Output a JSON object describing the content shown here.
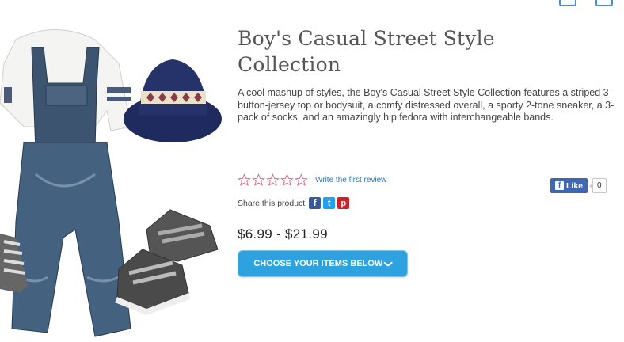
{
  "product": {
    "title": "Boy's Casual Street Style Collection",
    "description": "A cool mashup of styles, the Boy's Casual Street Style Collection features a striped 3-button-jersey top or bodysuit, a comfy distressed overall, a sporty 2-tone sneaker, a 3-pack of socks, and an amazingly hip fedora with interchangeable bands.",
    "rating_stars": 0,
    "review_link": "Write the first review",
    "share_label": "Share this product",
    "like_label": "Like",
    "like_count": "0",
    "price": "$6.99 - $21.99",
    "cta": "CHOOSE YOUR ITEMS BELOW"
  },
  "colors": {
    "star_outline": "#e06a8c",
    "link": "#2a7ab8",
    "cta_bg": "#2ea2e0",
    "facebook": "#3b5998",
    "twitter": "#1da1f2",
    "pinterest": "#cb2027"
  },
  "icons": [
    "star-outline-icon",
    "facebook-icon",
    "twitter-icon",
    "pinterest-icon",
    "chevron-down-icon"
  ]
}
